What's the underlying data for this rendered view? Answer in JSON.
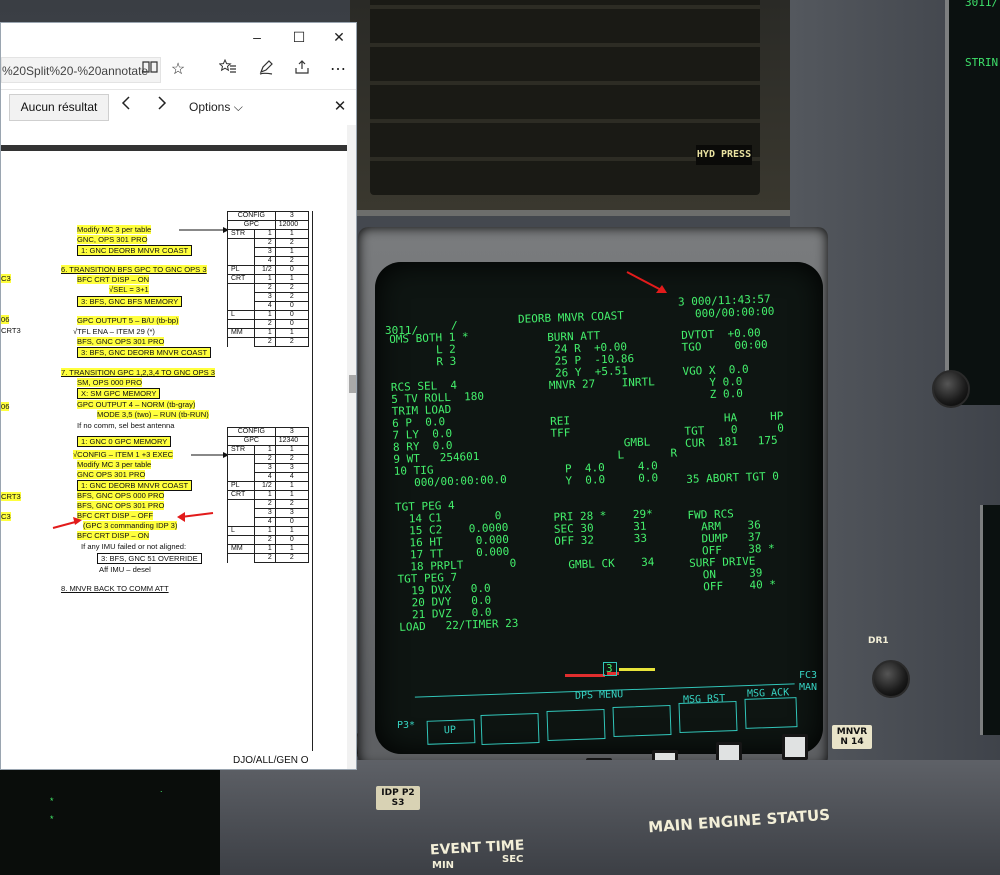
{
  "browser": {
    "url": "%20Split%20-%20annotate",
    "window_controls": {
      "minimize": "–",
      "maximize": "☐",
      "close": "✕"
    },
    "find_result": "Aucun résultat",
    "find_options": "Options",
    "page_footer": "DJO/ALL/GEN O"
  },
  "doc": {
    "lines_left_margin": [
      "C3",
      "06",
      "CRT3",
      "06",
      "CRT3",
      "C3"
    ],
    "steps": [
      {
        "text": "Modify MC 3 per table"
      },
      {
        "text": "GNC, OPS 301 PRO"
      },
      {
        "text": "1:  GNC DEORB MNVR COAST"
      },
      {
        "text": "6.  TRANSITION BFS GPC TO GNC OPS 3"
      },
      {
        "text": "BFC CRT DISP – ON"
      },
      {
        "text": "√SEL = 3+1"
      },
      {
        "text": "3:  BFS, GNC BFS MEMORY"
      },
      {
        "text": "GPC OUTPUT 5 – B/U (tb-bp)"
      },
      {
        "text": "√TFL ENA – ITEM 29 (*)"
      },
      {
        "text": "BFS, GNC OPS 301 PRO"
      },
      {
        "text": "3:  BFS, GNC DEORB MNVR COAST"
      },
      {
        "text": "7.  TRANSITION GPC 1,2,3,4 TO GNC OPS 3"
      },
      {
        "text": "SM, OPS 000 PRO"
      },
      {
        "text": "X:  SM GPC MEMORY"
      },
      {
        "text": "GPC OUTPUT 4 – NORM (tb-gray)"
      },
      {
        "text": "MODE 3,5 (two) – RUN (tb-RUN)"
      },
      {
        "text": "If no comm, sel best antenna"
      },
      {
        "text": "1:  GNC 0 GPC MEMORY"
      },
      {
        "text": "√CONFIG – ITEM 1 +3 EXEC"
      },
      {
        "text": "Modify MC 3 per table"
      },
      {
        "text": "GNC OPS 301 PRO"
      },
      {
        "text": "1:  GNC DEORB MNVR COAST"
      },
      {
        "text": "BFS, GNC OPS 000 PRO"
      },
      {
        "text": "BFS, GNC OPS 301 PRO"
      },
      {
        "text": "BFC CRT DISP – OFF"
      },
      {
        "text": "(GPC 3 commanding IDP 3)"
      },
      {
        "text": "BFC CRT DISP – ON"
      },
      {
        "text": "If any IMU failed or not aligned:"
      },
      {
        "text": "3:  BFS, GNC 51 OVERRIDE"
      },
      {
        "text": "Aff IMU – desel"
      },
      {
        "text": "8.  MNVR BACK TO COMM ATT"
      }
    ],
    "table1": {
      "header": [
        "CONFIG",
        "3"
      ],
      "header2": [
        "GPC",
        "12000"
      ],
      "rows": [
        [
          "STR",
          "1",
          "1"
        ],
        [
          "",
          "2",
          "2"
        ],
        [
          "",
          "3",
          "1"
        ],
        [
          "",
          "4",
          "2"
        ],
        [
          "PL",
          "1/2",
          "0"
        ],
        [
          "CRT",
          "1",
          "1"
        ],
        [
          "",
          "2",
          "2"
        ],
        [
          "",
          "3",
          "2"
        ],
        [
          "",
          "4",
          "0"
        ],
        [
          "L",
          "1",
          "0"
        ],
        [
          "",
          "2",
          "0"
        ],
        [
          "MM",
          "1",
          "1"
        ],
        [
          "",
          "2",
          "2"
        ]
      ]
    },
    "table2": {
      "header": [
        "CONFIG",
        "3"
      ],
      "header2": [
        "GPC",
        "12340"
      ],
      "rows": [
        [
          "STR",
          "1",
          "1"
        ],
        [
          "",
          "2",
          "2"
        ],
        [
          "",
          "3",
          "3"
        ],
        [
          "",
          "4",
          "4"
        ],
        [
          "PL",
          "1/2",
          "1"
        ],
        [
          "CRT",
          "1",
          "1"
        ],
        [
          "",
          "2",
          "2"
        ],
        [
          "",
          "3",
          "3"
        ],
        [
          "",
          "4",
          "0"
        ],
        [
          "L",
          "1",
          "1"
        ],
        [
          "",
          "2",
          "0"
        ],
        [
          "MM",
          "1",
          "1"
        ],
        [
          "",
          "2",
          "2"
        ]
      ]
    }
  },
  "crt": {
    "page_id": "3011/",
    "slash": "/",
    "title": "DEORB MNVR COAST",
    "time1": "3 000/11:43:57",
    "time2": "000/00:00:00",
    "left_col": [
      "OMS BOTH 1 *",
      "       L 2",
      "       R 3",
      "",
      "RCS SEL  4",
      "5 TV ROLL  180",
      "TRIM LOAD",
      "6 P  0.0",
      "7 LY  0.0",
      "8 RY  0.0",
      "9 WT   254601",
      "10 TIG",
      "   000/00:00:00.0",
      "",
      "TGT PEG 4",
      "  14 C1        0",
      "  15 C2    0.0000",
      "  16 HT     0.000",
      "  17 TT     0.000",
      "  18 PRPLT       0",
      "TGT PEG 7",
      "  19 DVX   0.0",
      "  20 DVY   0.0",
      "  21 DVZ   0.0",
      "LOAD   22/TIMER 23"
    ],
    "mid_col": [
      "BURN ATT",
      " 24 R  +0.00",
      " 25 P  -10.86",
      " 26 Y  +5.51",
      "MNVR 27    INRTL",
      "",
      "",
      "REI",
      "TFF",
      "           GMBL",
      "          L       R",
      "  P  4.0     4.0",
      "  Y  0.0     0.0",
      "",
      "",
      "PRI 28 *    29*",
      "SEC 30      31",
      "OFF 32      33",
      "",
      "  GMBL CK    34"
    ],
    "right_col": [
      "DVTOT  +0.00",
      "TGO     00:00",
      "",
      "VGO X  0.0",
      "    Y 0.0",
      "    Z 0.0",
      "",
      "      HA     HP",
      "TGT    0      0",
      "CUR  181   175",
      "",
      "",
      "35 ABORT TGT 0",
      "",
      "",
      "FWD RCS",
      "  ARM    36",
      "  DUMP   37",
      "  OFF    38 *",
      "SURF DRIVE",
      "  ON     39",
      "  OFF    40 *"
    ],
    "progress_marker": "3",
    "softkeys": {
      "up": "UP",
      "dps_menu": "DPS MENU",
      "msg_rst": "MSG RST",
      "msg_ack": "MSG ACK",
      "fc3": "FC3",
      "man": "MAN",
      "p3": "P3*"
    }
  },
  "cockpit": {
    "hyd_press": "HYD PRESS",
    "dr1": "DR1",
    "idp_p2": "IDP P2",
    "idp_s3": "S3",
    "main_engine_status": "MAIN ENGINE STATUS",
    "event_time": "EVENT TIME",
    "min": "MIN",
    "sec": "SEC",
    "mnvr_placard": "MNVR",
    "mnvr_placard2": "N 14",
    "strip_right": "STRIN",
    "right_top": "3011/"
  },
  "colors": {
    "crt_green": "#44f06c",
    "crt_cyan": "#36d3c2",
    "highlight": "#ffff3d",
    "annotation_red": "#e21b1b"
  }
}
